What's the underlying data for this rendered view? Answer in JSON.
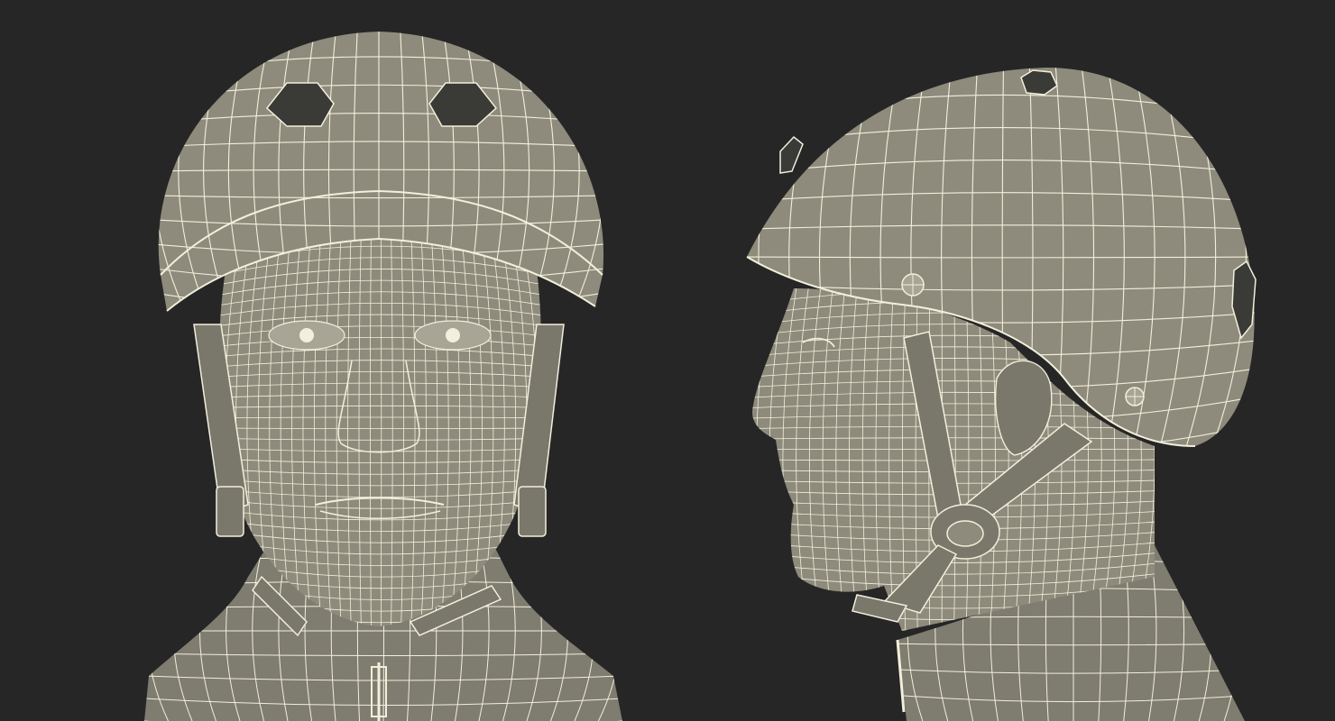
{
  "scene": {
    "subject": "wireframe-helmet-head",
    "views": [
      "front-view",
      "side-view"
    ],
    "colors": {
      "background": "#262626",
      "surface": "#8e8b7c",
      "surface_shadow": "#6e6c62",
      "surface_light": "#a8a596",
      "wire": "#f2efdc",
      "vent": "#3a3a36"
    }
  }
}
